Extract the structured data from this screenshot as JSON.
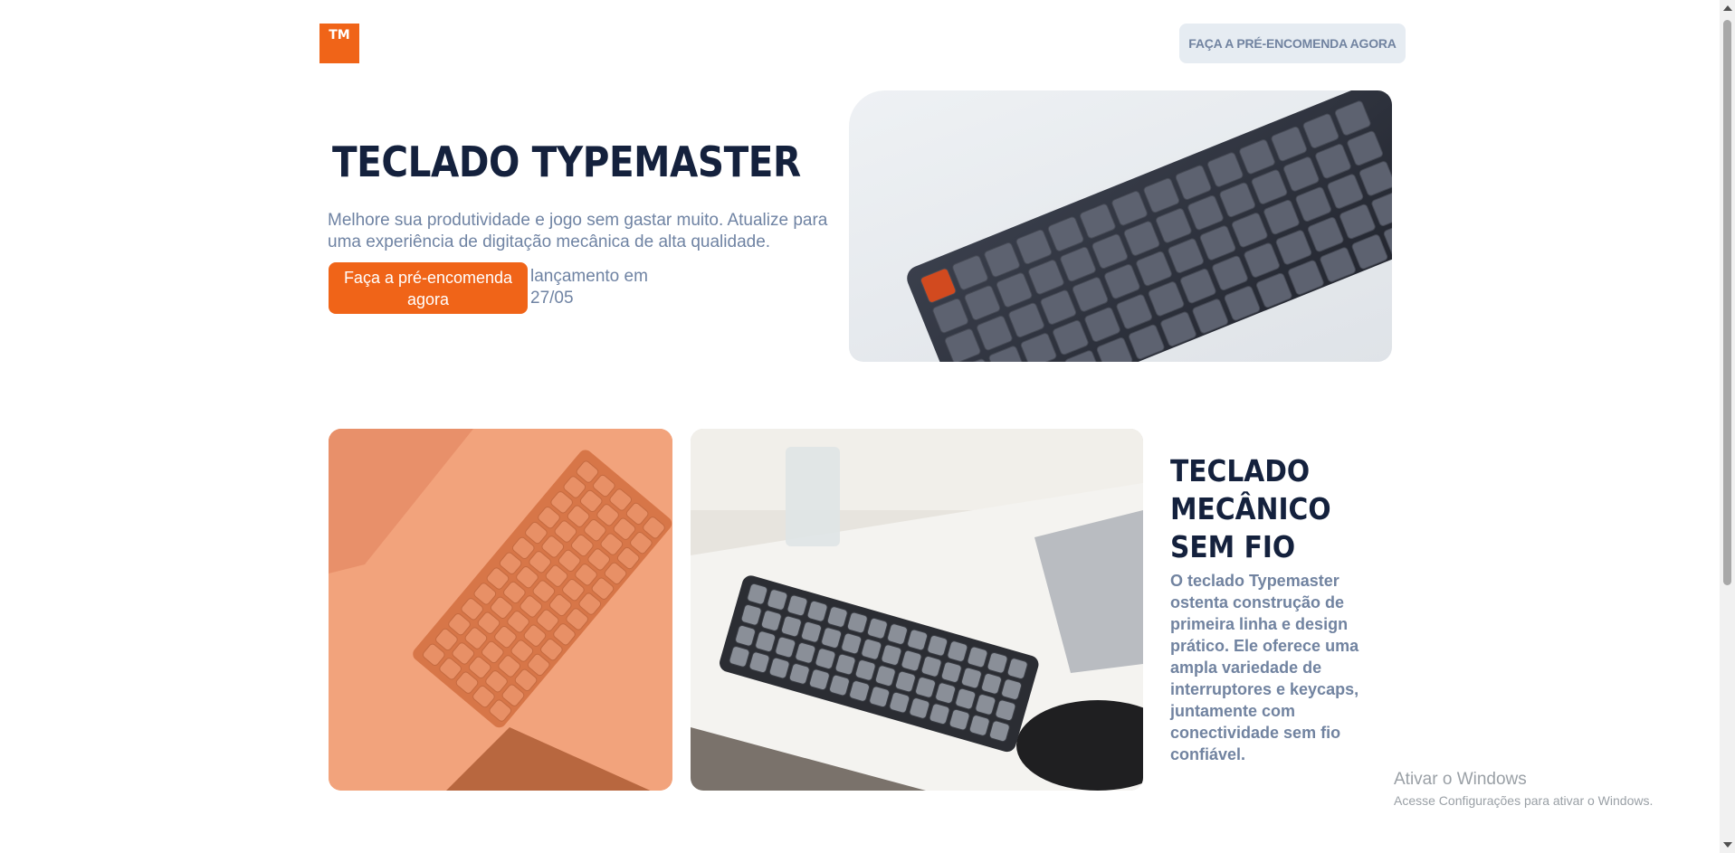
{
  "header": {
    "logo_text": "TM",
    "preorder_nav_label": "FAÇA A PRÉ-ENCOMENDA AGORA"
  },
  "hero": {
    "title": "TECLADO TYPEMASTER",
    "description": "Melhore sua produtividade e jogo sem gastar muito. Atualize para uma experiência de digitação mecânica de alta qualidade.",
    "cta_label": "Faça a pré-encomenda agora",
    "launch_text": "lançamento em 27/05"
  },
  "feature": {
    "title": "TECLADO MECÂNICO SEM FIO",
    "description": "O teclado Typemaster ostenta construção de primeira linha e design prático. Ele oferece uma ampla variedade de interruptores e keycaps, juntamente com conectividade sem fio confiável."
  },
  "windows_watermark": {
    "line1": "Ativar o Windows",
    "line2": "Acesse Configurações para ativar o Windows."
  },
  "colors": {
    "brand_orange": "#f06418",
    "heading_navy": "#14213d",
    "body_gray_blue": "#6f83a3"
  }
}
